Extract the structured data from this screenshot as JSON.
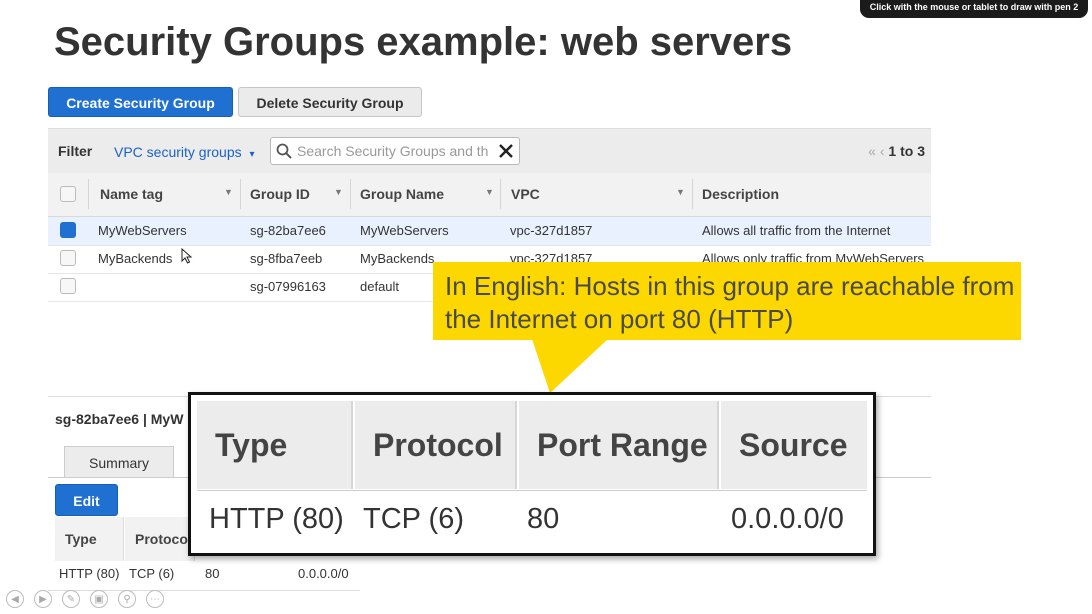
{
  "slide": {
    "title": "Security Groups example: web servers",
    "pen_tip": "Click with the mouse or tablet to draw with pen 2"
  },
  "toolbar": {
    "create_label": "Create Security Group",
    "delete_label": "Delete Security Group"
  },
  "filter": {
    "label": "Filter",
    "selected": "VPC security groups",
    "search_placeholder": "Search Security Groups and th",
    "pager": "1 to 3"
  },
  "table": {
    "columns": [
      "Name tag",
      "Group ID",
      "Group Name",
      "VPC",
      "Description"
    ],
    "rows": [
      {
        "name": "MyWebServers",
        "group_id": "sg-82ba7ee6",
        "group_name": "MyWebServers",
        "vpc": "vpc-327d1857",
        "description": "Allows all traffic from the Internet",
        "selected": true
      },
      {
        "name": "MyBackends",
        "group_id": "sg-8fba7eeb",
        "group_name": "MyBackends",
        "vpc": "vpc-327d1857",
        "description": "Allows only traffic from MyWebServers",
        "selected": false
      },
      {
        "name": "",
        "group_id": "sg-07996163",
        "group_name": "default",
        "vpc": "",
        "description": "",
        "selected": false
      }
    ]
  },
  "detail": {
    "title": "sg-82ba7ee6 | MyW",
    "tab_summary": "Summary",
    "edit_label": "Edit",
    "columns": [
      "Type",
      "Protocol"
    ],
    "row": {
      "type": "HTTP (80)",
      "protocol": "TCP (6)",
      "port": "80",
      "source": "0.0.0.0/0"
    }
  },
  "callout": {
    "text": "In English: Hosts in this group are reachable from the Internet on port 80 (HTTP)",
    "color": "#fcd800"
  },
  "zoom": {
    "headers": [
      "Type",
      "Protocol",
      "Port Range",
      "Source"
    ],
    "values": [
      "HTTP (80)",
      "TCP (6)",
      "80",
      "0.0.0.0/0"
    ]
  },
  "colors": {
    "accent": "#1f70d0",
    "selected_row": "#e8f1fd"
  }
}
